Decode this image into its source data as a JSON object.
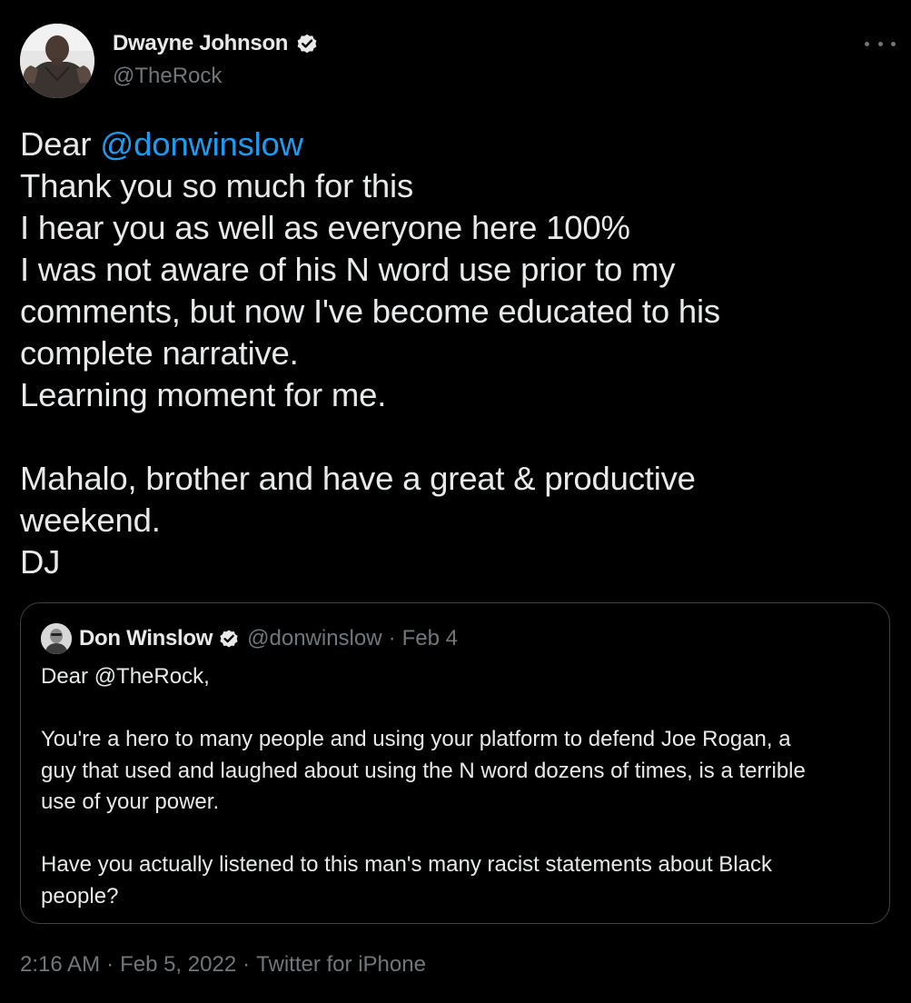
{
  "author": {
    "name": "Dwayne Johnson",
    "handle": "@TheRock",
    "verified": true
  },
  "icons": {
    "more": "more-horizontal-icon",
    "verified": "verified-badge-icon"
  },
  "colors": {
    "background": "#000000",
    "text": "#e7e9ea",
    "secondary": "#71767b",
    "link": "#1d9bf0",
    "border": "#3e4144"
  },
  "tweet": {
    "line1_prefix": "Dear ",
    "line1_mention": "@donwinslow",
    "lines": [
      "Thank you so much for this",
      "I hear you as well as everyone here 100%",
      "I was not aware of his N word use prior to my",
      "comments, but now I've become educated to his",
      "complete narrative.",
      "Learning moment for me."
    ],
    "closing": [
      "Mahalo, brother and have a great & productive",
      "weekend.",
      "DJ"
    ]
  },
  "quote": {
    "name": "Don Winslow",
    "handle": "@donwinslow",
    "separator": "·",
    "date": "Feb 4",
    "greeting": "Dear @TheRock,",
    "paragraph1": [
      "You're a hero to many people and using your platform to defend Joe Rogan, a",
      "guy that used and laughed about using the N word dozens of times, is a terrible",
      "use of your power."
    ],
    "paragraph2": [
      "Have you actually listened to this man's many racist statements about Black",
      "people?"
    ]
  },
  "meta": {
    "time": "2:16 AM",
    "date": "Feb 5, 2022",
    "source": "Twitter for iPhone",
    "separator": "·"
  }
}
